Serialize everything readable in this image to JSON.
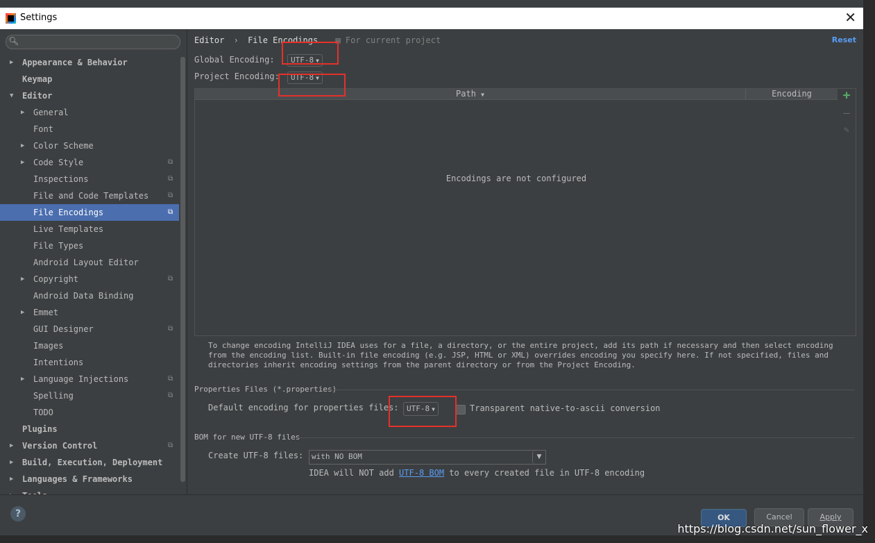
{
  "window": {
    "title": "Settings",
    "close_glyph": "✕"
  },
  "sidebar": {
    "search_placeholder": "",
    "search_icon": "search-icon",
    "items": [
      {
        "label": "Appearance & Behavior",
        "level": 0,
        "expandable": true,
        "expanded": false,
        "project": false
      },
      {
        "label": "Keymap",
        "level": 0,
        "expandable": false,
        "expanded": false,
        "project": false
      },
      {
        "label": "Editor",
        "level": 0,
        "expandable": true,
        "expanded": true,
        "project": false
      },
      {
        "label": "General",
        "level": 1,
        "expandable": true,
        "expanded": false,
        "project": false
      },
      {
        "label": "Font",
        "level": 1,
        "expandable": false,
        "expanded": false,
        "project": false
      },
      {
        "label": "Color Scheme",
        "level": 1,
        "expandable": true,
        "expanded": false,
        "project": false
      },
      {
        "label": "Code Style",
        "level": 1,
        "expandable": true,
        "expanded": false,
        "project": true
      },
      {
        "label": "Inspections",
        "level": 1,
        "expandable": false,
        "expanded": false,
        "project": true
      },
      {
        "label": "File and Code Templates",
        "level": 1,
        "expandable": false,
        "expanded": false,
        "project": true
      },
      {
        "label": "File Encodings",
        "level": 1,
        "expandable": false,
        "expanded": false,
        "project": true,
        "selected": true
      },
      {
        "label": "Live Templates",
        "level": 1,
        "expandable": false,
        "expanded": false,
        "project": false
      },
      {
        "label": "File Types",
        "level": 1,
        "expandable": false,
        "expanded": false,
        "project": false
      },
      {
        "label": "Android Layout Editor",
        "level": 1,
        "expandable": false,
        "expanded": false,
        "project": false
      },
      {
        "label": "Copyright",
        "level": 1,
        "expandable": true,
        "expanded": false,
        "project": true
      },
      {
        "label": "Android Data Binding",
        "level": 1,
        "expandable": false,
        "expanded": false,
        "project": false
      },
      {
        "label": "Emmet",
        "level": 1,
        "expandable": true,
        "expanded": false,
        "project": false
      },
      {
        "label": "GUI Designer",
        "level": 1,
        "expandable": false,
        "expanded": false,
        "project": true
      },
      {
        "label": "Images",
        "level": 1,
        "expandable": false,
        "expanded": false,
        "project": false
      },
      {
        "label": "Intentions",
        "level": 1,
        "expandable": false,
        "expanded": false,
        "project": false
      },
      {
        "label": "Language Injections",
        "level": 1,
        "expandable": true,
        "expanded": false,
        "project": true
      },
      {
        "label": "Spelling",
        "level": 1,
        "expandable": false,
        "expanded": false,
        "project": true
      },
      {
        "label": "TODO",
        "level": 1,
        "expandable": false,
        "expanded": false,
        "project": false
      },
      {
        "label": "Plugins",
        "level": 0,
        "expandable": false,
        "expanded": false,
        "project": false
      },
      {
        "label": "Version Control",
        "level": 0,
        "expandable": true,
        "expanded": false,
        "project": true
      },
      {
        "label": "Build, Execution, Deployment",
        "level": 0,
        "expandable": true,
        "expanded": false,
        "project": false
      },
      {
        "label": "Languages & Frameworks",
        "level": 0,
        "expandable": true,
        "expanded": false,
        "project": false
      },
      {
        "label": "Tools",
        "level": 0,
        "expandable": true,
        "expanded": false,
        "project": false
      }
    ]
  },
  "breadcrumb": {
    "parent": "Editor",
    "separator": "›",
    "current": "File Encodings",
    "scope_icon": "project-scope-icon",
    "scope_text": "For current project"
  },
  "reset_label": "Reset",
  "global_encoding": {
    "label": "Global Encoding:",
    "value": "UTF-8"
  },
  "project_encoding": {
    "label": "Project Encoding:",
    "value": "UTF-8"
  },
  "table": {
    "columns": [
      "Path",
      "Encoding"
    ],
    "empty_text": "Encodings are not configured",
    "toolbar": {
      "add": "+",
      "remove": "—",
      "edit": "✎"
    }
  },
  "hint": "To change encoding IntelliJ IDEA uses for a file, a directory, or the entire project, add its path if necessary and then select encoding from the encoding list. Built-in file encoding (e.g. JSP, HTML or XML) overrides encoding you specify here. If not specified, files and directories inherit encoding settings from the parent directory or from the Project Encoding.",
  "properties": {
    "section_title": "Properties Files (*.properties)",
    "default_label": "Default encoding for properties files:",
    "default_value": "UTF-8",
    "transparent_label": "Transparent native-to-ascii conversion",
    "transparent_checked": false
  },
  "bom": {
    "section_title": "BOM for new UTF-8 files",
    "create_label": "Create UTF-8 files:",
    "create_value": "with NO BOM",
    "note_prefix": "IDEA will NOT add ",
    "note_link": "UTF-8 BOM",
    "note_suffix": " to every created file in UTF-8 encoding"
  },
  "buttons": {
    "ok": "OK",
    "cancel": "Cancel",
    "apply": "Apply"
  },
  "help_label": "?",
  "watermark": "https://blog.csdn.net/sun_flower_x",
  "colors": {
    "selection": "#4b6eaf",
    "link": "#589df6",
    "annotation": "#e4312b",
    "add": "#59a869"
  }
}
